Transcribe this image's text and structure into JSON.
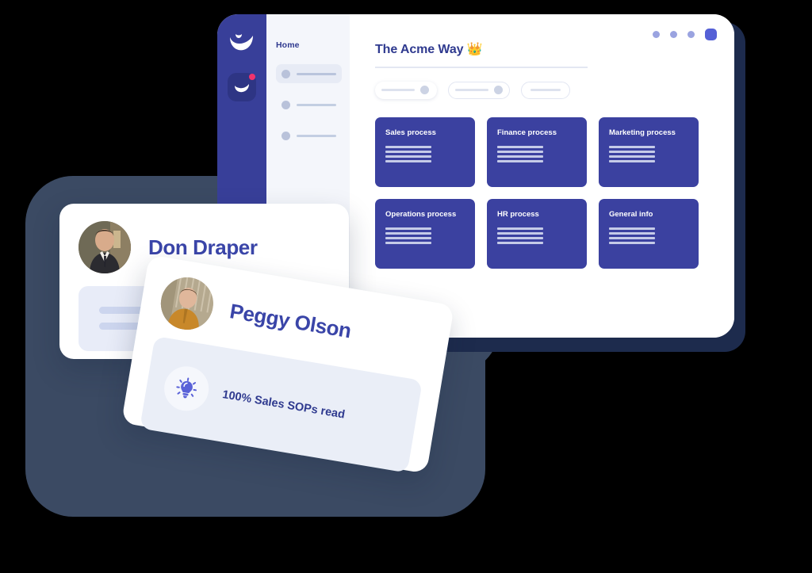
{
  "window": {
    "controls": [
      {
        "name": "dot-1",
        "shape": "dot",
        "color": "#9aa3e0"
      },
      {
        "name": "dot-2",
        "shape": "dot",
        "color": "#9aa3e0"
      },
      {
        "name": "dot-3",
        "shape": "dot",
        "color": "#9aa3e0"
      },
      {
        "name": "active-indicator",
        "shape": "rounded-square",
        "color": "#5560d6"
      }
    ]
  },
  "rail": {
    "logo_icon": "whale-logo-icon",
    "app_icon": "whale-app-icon",
    "badge_color": "#f2336d"
  },
  "sidebar": {
    "home_label": "Home",
    "items": [
      {
        "label": "",
        "active": true
      },
      {
        "label": "",
        "active": false
      },
      {
        "label": "",
        "active": false
      }
    ],
    "background": "#f4f6fb"
  },
  "main": {
    "title": "The Acme Way 👑",
    "chips": [
      {
        "name": "chip-1",
        "style": "elevated-toggle"
      },
      {
        "name": "chip-2",
        "style": "outlined-toggle"
      },
      {
        "name": "chip-3",
        "style": "outlined-pill"
      }
    ],
    "process_cards": [
      {
        "title": "Sales process",
        "lines": 4
      },
      {
        "title": "Finance process",
        "lines": 4
      },
      {
        "title": "Marketing process",
        "lines": 4
      },
      {
        "title": "Operations process",
        "lines": 4
      },
      {
        "title": "HR process",
        "lines": 4
      },
      {
        "title": "General info",
        "lines": 4
      }
    ],
    "card_color": "#3b41a0"
  },
  "people": [
    {
      "name": "Don Draper",
      "avatar": "don-draper-avatar",
      "panel_lines": 2
    },
    {
      "name": "Peggy Olson",
      "avatar": "peggy-olson-avatar",
      "stat_icon": "lightbulb-icon",
      "stat_text": "100% Sales SOPs read"
    }
  ],
  "colors": {
    "brand_blue": "#383f99",
    "card_blue": "#3b41a0",
    "text_blue": "#2f3a8f",
    "name_blue": "#3a45a8",
    "backdrop_navy": "#3b4a63",
    "window_shadow": "#1d2b4d",
    "accent_pink": "#f2336d",
    "bulb_purple": "#5a62d8"
  }
}
